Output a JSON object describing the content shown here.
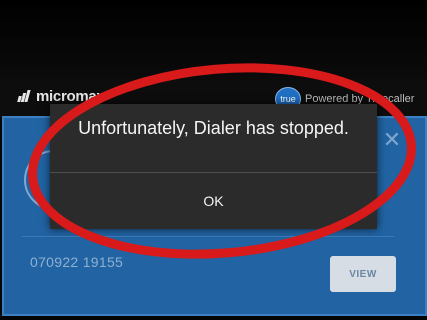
{
  "brand": {
    "name": "micromax"
  },
  "truecaller": {
    "badge": "true",
    "powered_by": "Powered by Truecaller"
  },
  "caller_card": {
    "number": "070922 19155",
    "view_label": "VIEW",
    "close_glyph": "✕"
  },
  "dialog": {
    "message": "Unfortunately, Dialer has stopped.",
    "ok_label": "OK"
  },
  "colors": {
    "card_blue": "#2163a3",
    "dialog_bg": "#2b2b2b",
    "highlight_red": "#d81a1a"
  }
}
